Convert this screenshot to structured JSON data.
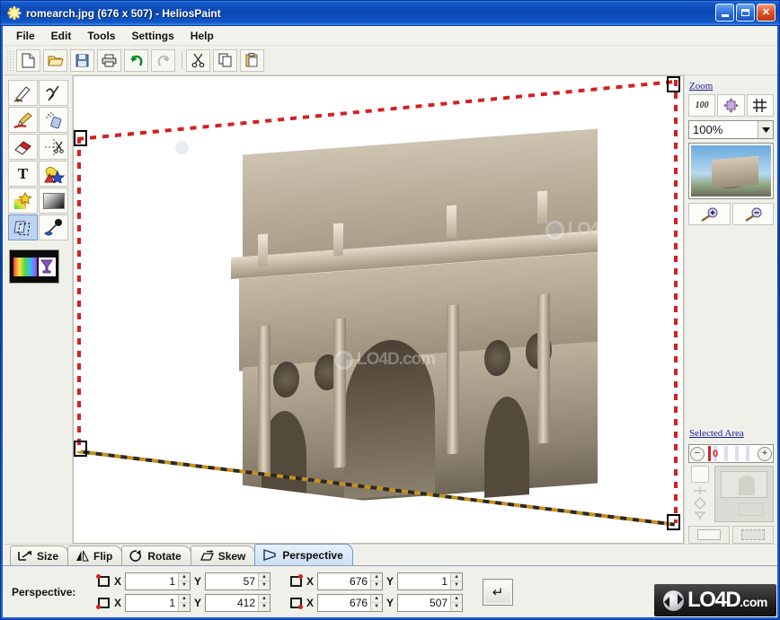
{
  "window": {
    "title": "romearch.jpg (676 x 507) - HeliosPaint",
    "app_icon": "sun-icon",
    "minimize_label": "Minimize",
    "maximize_label": "Maximize",
    "close_label": "Close"
  },
  "menubar": {
    "items": [
      {
        "label": "File",
        "name": "menu-file"
      },
      {
        "label": "Edit",
        "name": "menu-edit"
      },
      {
        "label": "Tools",
        "name": "menu-tools"
      },
      {
        "label": "Settings",
        "name": "menu-settings"
      },
      {
        "label": "Help",
        "name": "menu-help"
      }
    ]
  },
  "toolbar": {
    "buttons": [
      {
        "icon": "new-document-icon",
        "label": "New",
        "enabled": true
      },
      {
        "icon": "open-folder-icon",
        "label": "Open",
        "enabled": true
      },
      {
        "icon": "save-disk-icon",
        "label": "Save",
        "enabled": true
      },
      {
        "icon": "printer-icon",
        "label": "Print",
        "enabled": true
      },
      {
        "icon": "undo-arrow-icon",
        "label": "Undo",
        "enabled": true
      },
      {
        "icon": "redo-arrow-icon",
        "label": "Redo",
        "enabled": false
      },
      {
        "icon": "scissors-icon",
        "label": "Cut",
        "enabled": true
      },
      {
        "icon": "copy-icon",
        "label": "Copy",
        "enabled": true
      },
      {
        "icon": "paste-clipboard-icon",
        "label": "Paste",
        "enabled": true
      }
    ]
  },
  "palette": {
    "tools": [
      {
        "icon": "pencil-icon",
        "label": "Pencil",
        "selected": false
      },
      {
        "icon": "curve-icon",
        "label": "Curve",
        "selected": false
      },
      {
        "icon": "paintbrush-icon",
        "label": "Paintbrush",
        "selected": false
      },
      {
        "icon": "spray-can-icon",
        "label": "Airbrush",
        "selected": false
      },
      {
        "icon": "eraser-icon",
        "label": "Eraser",
        "selected": false
      },
      {
        "icon": "crop-scissors-icon",
        "label": "Crop",
        "selected": false
      },
      {
        "icon": "text-tool-icon",
        "label": "Text",
        "selected": false
      },
      {
        "icon": "shapes-icon",
        "label": "Shapes",
        "selected": false
      },
      {
        "icon": "magic-wand-icon",
        "label": "Magic Wand",
        "selected": false
      },
      {
        "icon": "gradient-icon",
        "label": "Gradient",
        "selected": false
      },
      {
        "icon": "transform-icon",
        "label": "Transform",
        "selected": true
      },
      {
        "icon": "fill-bucket-icon",
        "label": "Fill",
        "selected": false
      }
    ],
    "color_swatch": {
      "name": "color-swatch",
      "foreground": "#ff3b3b",
      "background": "#ffffff"
    }
  },
  "canvas": {
    "image_alt": "Arch of Constantine, Rome",
    "watermark": "LO4D.com",
    "selection": {
      "type": "perspective-quad",
      "handles": [
        "top-left",
        "top-right",
        "bottom-left",
        "bottom-right"
      ]
    }
  },
  "dock": {
    "zoom": {
      "title": "Zoom",
      "buttons": [
        {
          "icon": "zoom-100-icon",
          "label": "100"
        },
        {
          "icon": "fit-to-window-icon",
          "label": "Fit"
        },
        {
          "icon": "grid-icon",
          "label": "Grid"
        }
      ],
      "level": "100%",
      "zoom_in_label": "Zoom In",
      "zoom_out_label": "Zoom Out"
    },
    "selected_area": {
      "title": "Selected Area",
      "value": "0",
      "minus_label": "−",
      "plus_label": "+",
      "buttons": [
        {
          "icon": "select-rect-icon",
          "label": "Rectangle"
        },
        {
          "icon": "select-transform-icon",
          "label": "Transform"
        }
      ]
    }
  },
  "tabs": [
    {
      "label": "Size",
      "icon": "resize-icon",
      "active": false
    },
    {
      "label": "Flip",
      "icon": "flip-icon",
      "active": false
    },
    {
      "label": "Rotate",
      "icon": "rotate-icon",
      "active": false
    },
    {
      "label": "Skew",
      "icon": "skew-icon",
      "active": false
    },
    {
      "label": "Perspective",
      "icon": "perspective-icon",
      "active": true
    }
  ],
  "perspective_panel": {
    "label": "Perspective:",
    "x_label": "X",
    "y_label": "Y",
    "corners": [
      {
        "name": "top-left",
        "x": "1",
        "y": "57"
      },
      {
        "name": "top-right",
        "x": "676",
        "y": "1"
      },
      {
        "name": "bottom-left",
        "x": "1",
        "y": "412"
      },
      {
        "name": "bottom-right",
        "x": "676",
        "y": "507"
      }
    ],
    "apply_label": "↵"
  },
  "footer": {
    "logo_text": "LO4D",
    "logo_suffix": ".com"
  }
}
